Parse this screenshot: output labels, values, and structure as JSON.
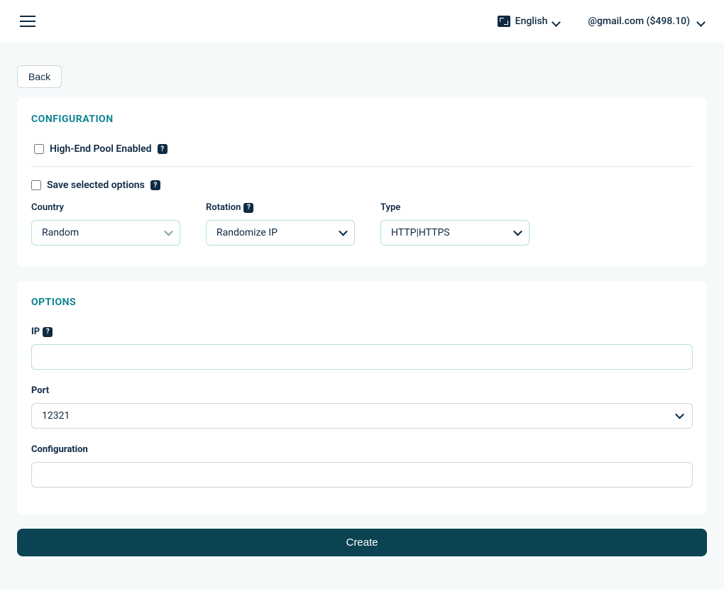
{
  "header": {
    "language": "English",
    "user": "@gmail.com ($498.10)"
  },
  "back_label": "Back",
  "config": {
    "title": "CONFIGURATION",
    "highend_label": "High-End Pool Enabled",
    "highend_checked": false,
    "save_label": "Save selected options",
    "save_checked": false,
    "country": {
      "label": "Country",
      "value": "Random"
    },
    "rotation": {
      "label": "Rotation",
      "value": "Randomize IP"
    },
    "type": {
      "label": "Type",
      "value": "HTTP|HTTPS"
    },
    "help_glyph": "?"
  },
  "options": {
    "title": "OPTIONS",
    "ip": {
      "label": "IP",
      "value": ""
    },
    "port": {
      "label": "Port",
      "value": "12321"
    },
    "configuration": {
      "label": "Configuration",
      "value": ""
    }
  },
  "create_label": "Create"
}
